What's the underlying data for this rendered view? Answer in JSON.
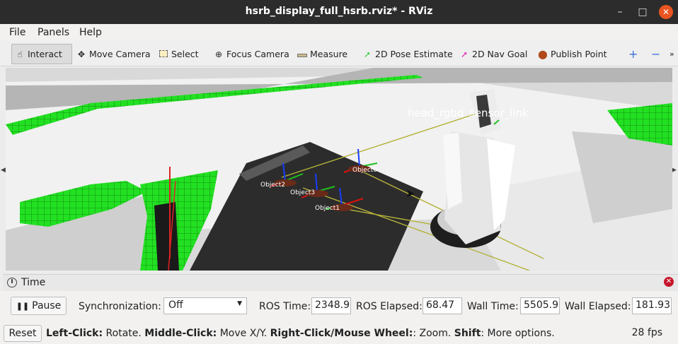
{
  "window": {
    "title": "hsrb_display_full_hsrb.rviz* - RViz",
    "minimize": "–",
    "maximize": "□",
    "close": "✕"
  },
  "menu": {
    "file": "File",
    "panels": "Panels",
    "help": "Help"
  },
  "toolbar": {
    "interact": "Interact",
    "move_camera": "Move Camera",
    "select": "Select",
    "focus_camera": "Focus Camera",
    "measure": "Measure",
    "pose_estimate": "2D Pose Estimate",
    "nav_goal": "2D Nav Goal",
    "publish_point": "Publish Point",
    "add": "+",
    "remove": "−",
    "more": "»"
  },
  "viewport": {
    "frame_labels": [
      "head_rgbd_sensor_link",
      "Object1",
      "Object2",
      "Object3",
      "Object0"
    ]
  },
  "time_panel": {
    "title": "Time",
    "pause_label": "Pause",
    "sync_label": "Synchronization:",
    "sync_value": "Off",
    "ros_time_label": "ROS Time:",
    "ros_time_value": "2348.91",
    "ros_elapsed_label": "ROS Elapsed:",
    "ros_elapsed_value": "68.47",
    "wall_time_label": "Wall Time:",
    "wall_time_value": "5505.93",
    "wall_elapsed_label": "Wall Elapsed:",
    "wall_elapsed_value": "181.93"
  },
  "status": {
    "reset_label": "Reset",
    "help_parts": [
      {
        "bold": "Left-Click:",
        "text": " Rotate. "
      },
      {
        "bold": "Middle-Click:",
        "text": " Move X/Y. "
      },
      {
        "bold": "Right-Click/Mouse Wheel:",
        "text": ": Zoom. "
      },
      {
        "bold": "Shift",
        "text": ": More options."
      }
    ],
    "fps": "28 fps"
  }
}
